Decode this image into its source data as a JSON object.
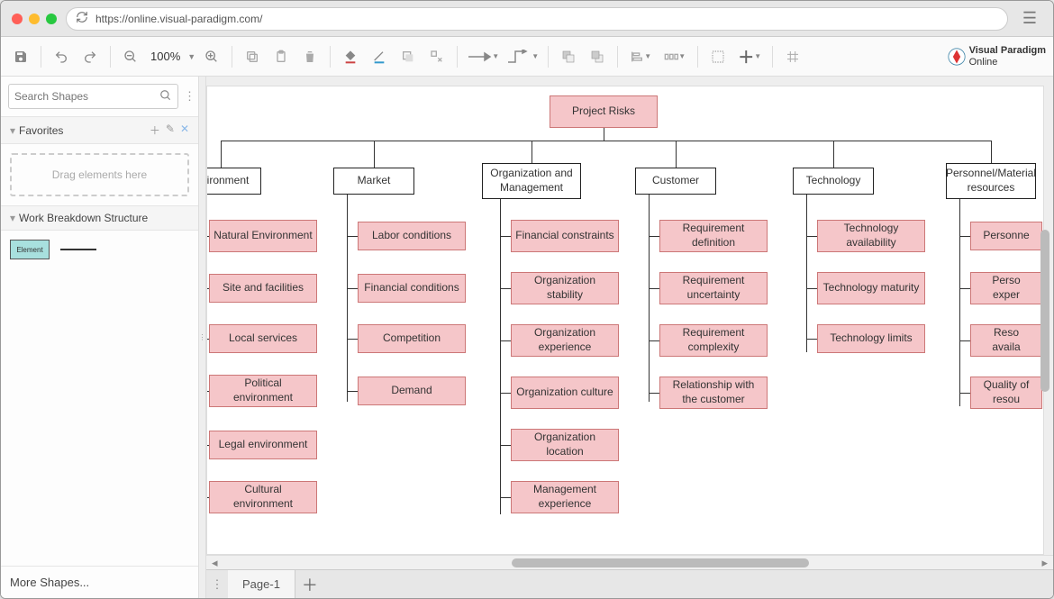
{
  "titlebar": {
    "url": "https://online.visual-paradigm.com/"
  },
  "toolbar": {
    "zoom": "100%"
  },
  "brand": {
    "line1": "Visual Paradigm",
    "line2": "Online"
  },
  "sidebar": {
    "search_placeholder": "Search Shapes",
    "favorites_label": "Favorites",
    "dropzone_text": "Drag elements here",
    "wbs_label": "Work Breakdown Structure",
    "palette_shape_label": "Element",
    "more_shapes": "More Shapes..."
  },
  "tabs": {
    "page1": "Page-1"
  },
  "chart_data": {
    "type": "tree",
    "root": "Project Risks",
    "branches": [
      {
        "label": "Environment",
        "truncated_left": true,
        "children": [
          "Natural Environment",
          "Site and facilities",
          "Local services",
          "Political environment",
          "Legal environment",
          "Cultural environment"
        ]
      },
      {
        "label": "Market",
        "children": [
          "Labor conditions",
          "Financial conditions",
          "Competition",
          "Demand"
        ]
      },
      {
        "label": "Organization and Management",
        "children": [
          "Financial constraints",
          "Organization stability",
          "Organization experience",
          "Organization culture",
          "Organization location",
          "Management experience"
        ]
      },
      {
        "label": "Customer",
        "children": [
          "Requirement definition",
          "Requirement uncertainty",
          "Requirement complexity",
          "Relationship with the customer"
        ]
      },
      {
        "label": "Technology",
        "children": [
          "Technology availability",
          "Technology maturity",
          "Technology limits"
        ]
      },
      {
        "label": "Personnel/Material resources",
        "truncated_right": true,
        "children": [
          "Personnel",
          "Personnel experience",
          "Resource availability",
          "Quality of resources"
        ]
      }
    ],
    "colors": {
      "root": "#f5c6c9",
      "branch": "#ffffff",
      "leaf": "#f5c6c9"
    }
  },
  "diagram": {
    "root": "Project Risks",
    "branch0": {
      "label": "vironment",
      "c0": "Natural Environment",
      "c1": "Site and facilities",
      "c2": "Local services",
      "c3": "Political environment",
      "c4": "Legal environment",
      "c5": "Cultural environment"
    },
    "branch1": {
      "label": "Market",
      "c0": "Labor conditions",
      "c1": "Financial conditions",
      "c2": "Competition",
      "c3": "Demand"
    },
    "branch2": {
      "label": "Organization and Management",
      "c0": "Financial constraints",
      "c1": "Organization stability",
      "c2": "Organization experience",
      "c3": "Organization culture",
      "c4": "Organization location",
      "c5": "Management experience"
    },
    "branch3": {
      "label": "Customer",
      "c0": "Requirement definition",
      "c1": "Requirement uncertainty",
      "c2": "Requirement complexity",
      "c3": "Relationship with the customer"
    },
    "branch4": {
      "label": "Technology",
      "c0": "Technology availability",
      "c1": "Technology maturity",
      "c2": "Technology limits"
    },
    "branch5": {
      "label": "Personnel/Material resources",
      "c0": "Personne",
      "c1": "Perso\nexper",
      "c2": "Reso\navaila",
      "c3": "Quality of\nresou"
    }
  }
}
